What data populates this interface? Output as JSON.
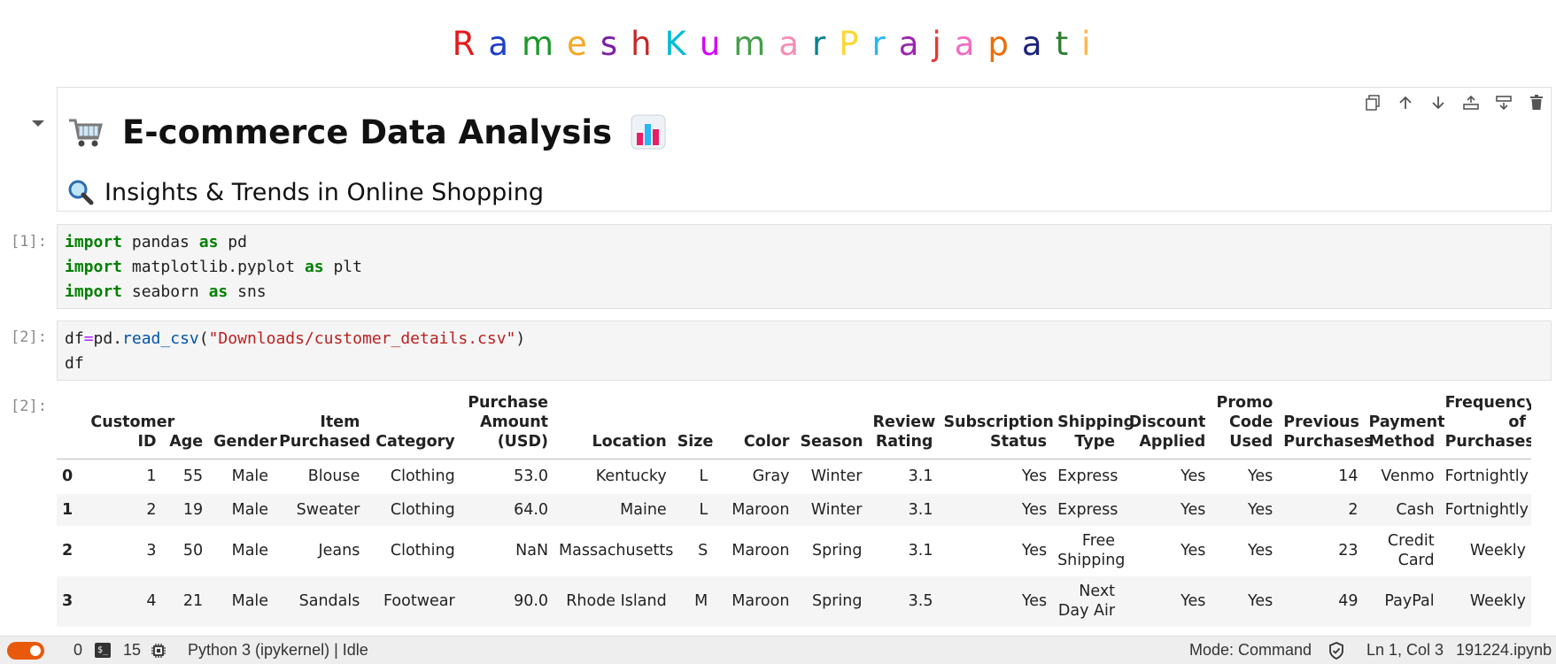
{
  "title": {
    "letters": [
      {
        "ch": "R",
        "color": "#e31a1c"
      },
      {
        "ch": "a",
        "color": "#1f3fc7"
      },
      {
        "ch": "m",
        "color": "#1a9a2a"
      },
      {
        "ch": "e",
        "color": "#f5a623"
      },
      {
        "ch": "s",
        "color": "#7b1fa2"
      },
      {
        "ch": "h",
        "color": "#c62828"
      },
      {
        "ch": "K",
        "color": "#00bcd4"
      },
      {
        "ch": "u",
        "color": "#d500f9"
      },
      {
        "ch": "m",
        "color": "#43a047"
      },
      {
        "ch": "a",
        "color": "#f48fb1"
      },
      {
        "ch": "r",
        "color": "#00838f"
      },
      {
        "ch": "P",
        "color": "#fdd835"
      },
      {
        "ch": "r",
        "color": "#29b6f6"
      },
      {
        "ch": "a",
        "color": "#9c27b0"
      },
      {
        "ch": "j",
        "color": "#e53935"
      },
      {
        "ch": "a",
        "color": "#f06cc4"
      },
      {
        "ch": "p",
        "color": "#ef6c00"
      },
      {
        "ch": "a",
        "color": "#1a237e"
      },
      {
        "ch": "t",
        "color": "#2e7d32"
      },
      {
        "ch": "i",
        "color": "#ffb74d"
      }
    ]
  },
  "markdown": {
    "h1": "E-commerce Data Analysis",
    "h2": "Insights & Trends in Online Shopping",
    "icons": [
      "shopping-cart-icon",
      "bar-chart-icon",
      "magnifier-icon"
    ]
  },
  "toolbar": [
    "duplicate-icon",
    "move-up-icon",
    "move-down-icon",
    "insert-above-icon",
    "insert-below-icon",
    "delete-icon"
  ],
  "cells": [
    {
      "prompt": "[1]:"
    },
    {
      "prompt": "[2]:"
    },
    {
      "prompt": "[2]:"
    }
  ],
  "code1": {
    "l1": {
      "kw1": "import",
      "mod": " pandas ",
      "kw2": "as",
      "alias": " pd"
    },
    "l2": {
      "kw1": "import",
      "mod": " matplotlib.pyplot ",
      "kw2": "as",
      "alias": " plt"
    },
    "l3": {
      "kw1": "import",
      "mod": " seaborn ",
      "kw2": "as",
      "alias": " sns"
    }
  },
  "code2": {
    "var": "df",
    "eq": "=",
    "obj": "pd.",
    "fn": "read_csv",
    "open": "(",
    "str": "\"Downloads/customer_details.csv\"",
    "close": ")",
    "l2": "df"
  },
  "dataframe": {
    "columns": [
      "Customer ID",
      "Age",
      "Gender",
      "Item Purchased",
      "Category",
      "Purchase Amount (USD)",
      "Location",
      "Size",
      "Color",
      "Season",
      "Review Rating",
      "Subscription Status",
      "Shipping Type",
      "Discount Applied",
      "Promo Code Used",
      "Previous Purchases",
      "Payment Method",
      "Frequency of Purchases"
    ],
    "rows": [
      {
        "index": "0",
        "cells": [
          "1",
          "55",
          "Male",
          "Blouse",
          "Clothing",
          "53.0",
          "Kentucky",
          "L",
          "Gray",
          "Winter",
          "3.1",
          "Yes",
          "Express",
          "Yes",
          "Yes",
          "14",
          "Venmo",
          "Fortnightly"
        ]
      },
      {
        "index": "1",
        "cells": [
          "2",
          "19",
          "Male",
          "Sweater",
          "Clothing",
          "64.0",
          "Maine",
          "L",
          "Maroon",
          "Winter",
          "3.1",
          "Yes",
          "Express",
          "Yes",
          "Yes",
          "2",
          "Cash",
          "Fortnightly"
        ]
      },
      {
        "index": "2",
        "cells": [
          "3",
          "50",
          "Male",
          "Jeans",
          "Clothing",
          "NaN",
          "Massachusetts",
          "S",
          "Maroon",
          "Spring",
          "3.1",
          "Yes",
          "Free Shipping",
          "Yes",
          "Yes",
          "23",
          "Credit Card",
          "Weekly"
        ]
      },
      {
        "index": "3",
        "cells": [
          "4",
          "21",
          "Male",
          "Sandals",
          "Footwear",
          "90.0",
          "Rhode Island",
          "M",
          "Maroon",
          "Spring",
          "3.5",
          "Yes",
          "Next Day Air",
          "Yes",
          "Yes",
          "49",
          "PayPal",
          "Weekly"
        ]
      }
    ]
  },
  "status": {
    "count1": "0",
    "count2": "15",
    "kernel": "Python 3 (ipykernel) | Idle",
    "mode": "Mode: Command",
    "position": "Ln 1, Col 3",
    "filename": "191224.ipynb",
    "toggle_color": "#e8590c"
  }
}
